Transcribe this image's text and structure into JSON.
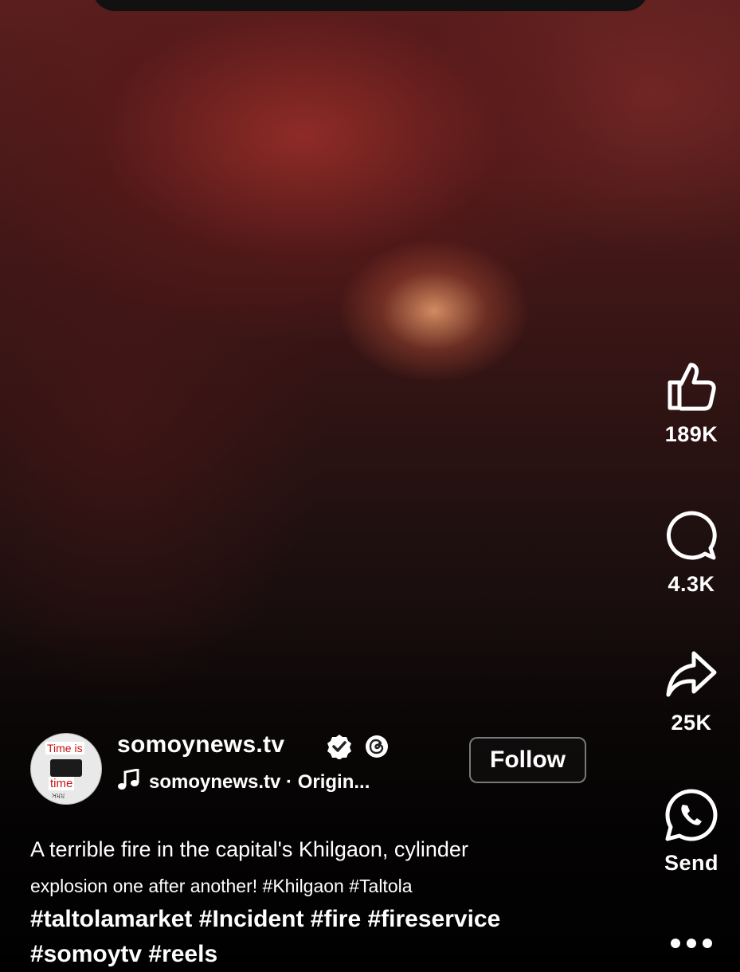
{
  "post": {
    "author": {
      "name": "somoynews.tv",
      "avatar_text": [
        "Time is",
        "time",
        "সময়"
      ]
    },
    "audio": "somoynews.tv · Origin...",
    "follow_label": "Follow",
    "caption_line1": "A terrible fire in the capital's Khilgaon, cylinder",
    "caption_line2": "explosion one after another! #Khilgaon #Taltola",
    "hashtags_line1": "#taltolamarket #Incident #fire #fireservice",
    "hashtags_line2": "#somoytv #reels"
  },
  "actions": {
    "likes": "189K",
    "comments": "4.3K",
    "shares": "25K",
    "send_label": "Send"
  },
  "icons": [
    "thumbs-up-icon",
    "comment-bubble-icon",
    "share-arrow-icon",
    "whatsapp-icon",
    "more-options-icon",
    "verified-badge-icon",
    "threads-icon",
    "music-note-icon"
  ]
}
